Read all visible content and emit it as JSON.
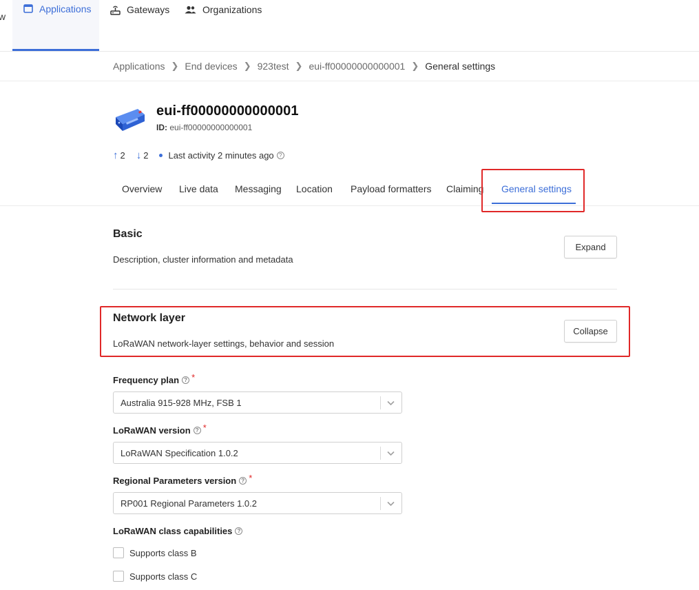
{
  "nav": {
    "cut_item": "w",
    "items": [
      {
        "label": "Applications",
        "icon": "application-window-icon",
        "active": true
      },
      {
        "label": "Gateways",
        "icon": "gateway-icon",
        "active": false
      },
      {
        "label": "Organizations",
        "icon": "organization-people-icon",
        "active": false
      }
    ]
  },
  "breadcrumb": {
    "items": [
      "Applications",
      "End devices",
      "923test",
      "eui-ff00000000000001",
      "General settings"
    ]
  },
  "device": {
    "icon": "end-device-icon",
    "title": "eui-ff00000000000001",
    "id_label": "ID:",
    "id_value": "eui-ff00000000000001"
  },
  "stats": {
    "uplink_count": "2",
    "downlink_count": "2",
    "last_activity": "Last activity 2 minutes ago"
  },
  "tabs": [
    "Overview",
    "Live data",
    "Messaging",
    "Location",
    "Payload formatters",
    "Claiming",
    "General settings"
  ],
  "active_tab": "General settings",
  "sections": {
    "basic": {
      "title": "Basic",
      "description": "Description, cluster information and metadata",
      "button": "Expand"
    },
    "network": {
      "title": "Network layer",
      "description": "LoRaWAN network-layer settings, behavior and session",
      "button": "Collapse"
    }
  },
  "form": {
    "frequency_plan": {
      "label": "Frequency plan",
      "value": "Australia 915-928 MHz, FSB 1",
      "required": "*"
    },
    "lorawan_version": {
      "label": "LoRaWAN version",
      "value": "LoRaWAN Specification 1.0.2",
      "required": "*"
    },
    "regional_params": {
      "label": "Regional Parameters version",
      "value": "RP001 Regional Parameters 1.0.2",
      "required": "*"
    },
    "class_caps": {
      "label": "LoRaWAN class capabilities",
      "class_b": "Supports class B",
      "class_c": "Supports class C"
    }
  },
  "colors": {
    "accent": "#3c6ed8",
    "highlight": "#e02828"
  }
}
